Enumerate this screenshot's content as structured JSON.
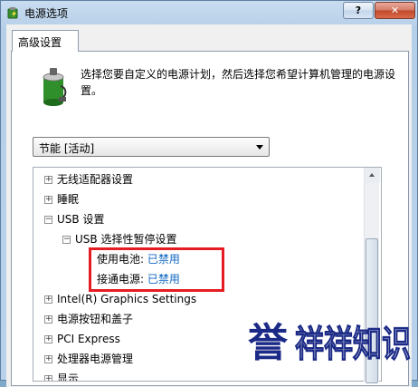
{
  "window": {
    "title": "电源选项",
    "help_label": "?",
    "close_label": "✕"
  },
  "tab": {
    "label": "高级设置"
  },
  "description": "选择您要自定义的电源计划，然后选择您希望计算机管理的电源设置。",
  "plan_select": {
    "value": "节能 [活动]"
  },
  "tree": {
    "items": [
      {
        "label": "无线适配器设置",
        "expander": "+"
      },
      {
        "label": "睡眠",
        "expander": "+"
      },
      {
        "label": "USB 设置",
        "expander": "−"
      },
      {
        "label": "USB 选择性暂停设置",
        "expander": "−"
      },
      {
        "label": "Intel(R) Graphics Settings",
        "expander": "+"
      },
      {
        "label": "电源按钮和盖子",
        "expander": "+"
      },
      {
        "label": "PCI Express",
        "expander": "+"
      },
      {
        "label": "处理器电源管理",
        "expander": "+"
      },
      {
        "label": "显示",
        "expander": "+"
      }
    ],
    "settings": [
      {
        "name": "使用电池:",
        "value": "已禁用"
      },
      {
        "name": "接通电源:",
        "value": "已禁用"
      }
    ]
  },
  "watermark": {
    "text": "誉祥祥知识",
    "first_char": "誉"
  },
  "colors": {
    "highlight": "#e51c22",
    "link_value": "#0f66c0",
    "watermark": "#1b2a86"
  }
}
